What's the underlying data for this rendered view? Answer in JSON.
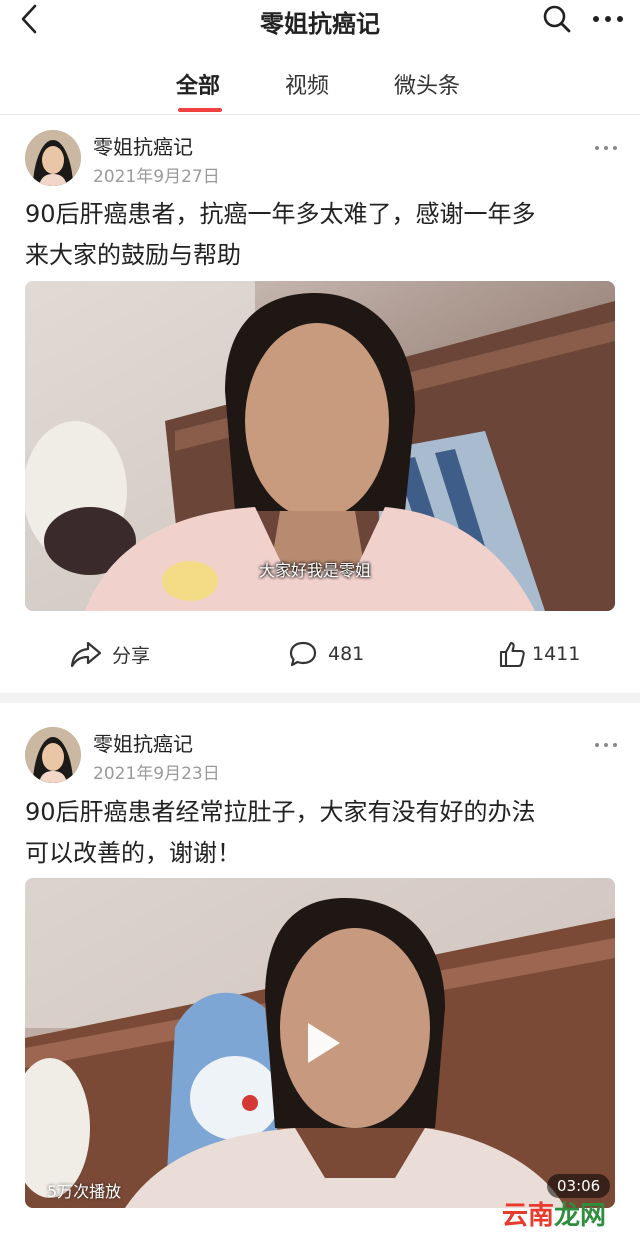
{
  "header": {
    "title": "零姐抗癌记",
    "back_icon": "chevron-left-icon",
    "search_icon": "search-icon",
    "more_icon": "more-horizontal-icon"
  },
  "tabs": [
    {
      "label": "全部",
      "active": true
    },
    {
      "label": "视频",
      "active": false
    },
    {
      "label": "微头条",
      "active": false
    }
  ],
  "accent_color": "#f04142",
  "posts": [
    {
      "author": "零姐抗癌记",
      "date": "2021年9月27日",
      "text_lines": [
        "90后肝癌患者，抗癌一年多太难了，感谢一年多",
        "来大家的鼓励与帮助"
      ],
      "media": {
        "subtitle": "大家好我是零姐"
      },
      "actions": {
        "share": "分享",
        "comments": "481",
        "likes": "1411"
      }
    },
    {
      "author": "零姐抗癌记",
      "date": "2021年9月23日",
      "text_lines": [
        "90后肝癌患者经常拉肚子，大家有没有好的办法",
        "可以改善的，谢谢！"
      ],
      "media": {
        "play_count": "5万次播放",
        "duration": "03:06"
      }
    }
  ],
  "watermark": {
    "part1": "云南",
    "part2": "龙网"
  }
}
